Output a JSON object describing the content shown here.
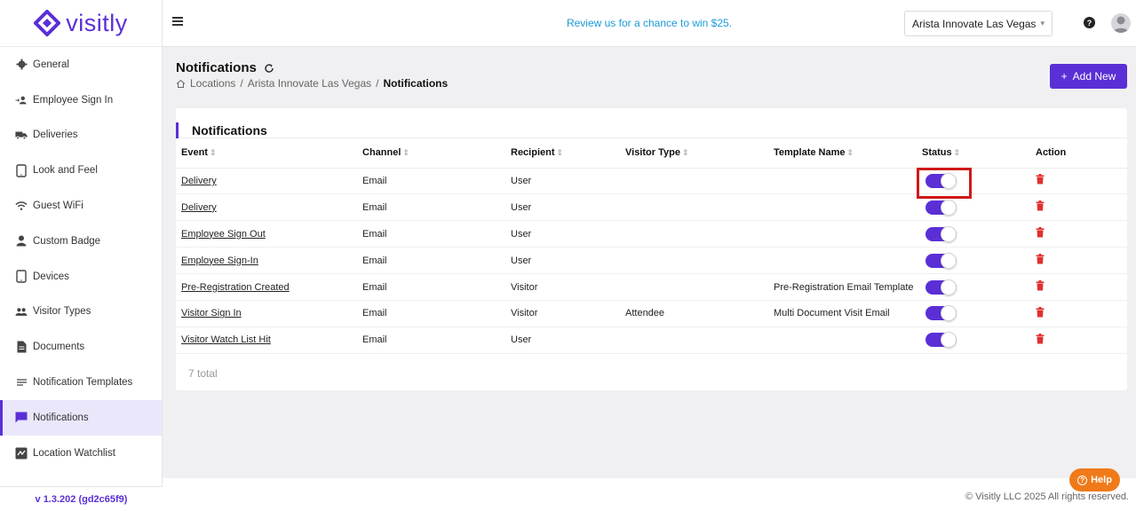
{
  "app": {
    "logo_text": "visitly",
    "version": "v 1.3.202 (gd2c65f9)",
    "brand_color": "#5a2fd6"
  },
  "sidebar": {
    "items": [
      {
        "label": "General",
        "icon": "gear-icon"
      },
      {
        "label": "Employee Sign In",
        "icon": "employee-sign-in-icon"
      },
      {
        "label": "Deliveries",
        "icon": "truck-icon"
      },
      {
        "label": "Look and Feel",
        "icon": "tablet-icon"
      },
      {
        "label": "Guest WiFi",
        "icon": "wifi-icon"
      },
      {
        "label": "Custom Badge",
        "icon": "person-icon"
      },
      {
        "label": "Devices",
        "icon": "tablet-icon"
      },
      {
        "label": "Visitor Types",
        "icon": "people-icon"
      },
      {
        "label": "Documents",
        "icon": "document-icon"
      },
      {
        "label": "Notification Templates",
        "icon": "lines-icon"
      },
      {
        "label": "Notifications",
        "icon": "chat-icon",
        "active": true
      },
      {
        "label": "Location Watchlist",
        "icon": "map-icon"
      }
    ]
  },
  "header": {
    "promo": "Review us for a chance to win $25.",
    "location": "Arista Innovate Las Vegas"
  },
  "page": {
    "title": "Notifications",
    "breadcrumb": [
      "Locations",
      "Arista Innovate Las Vegas",
      "Notifications"
    ],
    "add_button": "Add New"
  },
  "table": {
    "title": "Notifications",
    "columns": [
      "Event",
      "Channel",
      "Recipient",
      "Visitor Type",
      "Template Name",
      "Status",
      "Action"
    ],
    "rows": [
      {
        "event": "Delivery",
        "channel": "Email",
        "recipient": "User",
        "visitor_type": "",
        "template": "",
        "status": true
      },
      {
        "event": "Delivery",
        "channel": "Email",
        "recipient": "User",
        "visitor_type": "",
        "template": "",
        "status": true
      },
      {
        "event": "Employee Sign Out",
        "channel": "Email",
        "recipient": "User",
        "visitor_type": "",
        "template": "",
        "status": true
      },
      {
        "event": "Employee Sign-In",
        "channel": "Email",
        "recipient": "User",
        "visitor_type": "",
        "template": "",
        "status": true
      },
      {
        "event": "Pre-Registration Created",
        "channel": "Email",
        "recipient": "Visitor",
        "visitor_type": "",
        "template": "Pre-Registration Email Template",
        "status": true
      },
      {
        "event": "Visitor Sign In",
        "channel": "Email",
        "recipient": "Visitor",
        "visitor_type": "Attendee",
        "template": "Multi Document Visit Email",
        "status": true
      },
      {
        "event": "Visitor Watch List Hit",
        "channel": "Email",
        "recipient": "User",
        "visitor_type": "",
        "template": "",
        "status": true
      }
    ],
    "total": "7 total"
  },
  "footer": {
    "copyright": "© Visitly LLC 2025 All rights reserved.",
    "help_label": "Help"
  }
}
